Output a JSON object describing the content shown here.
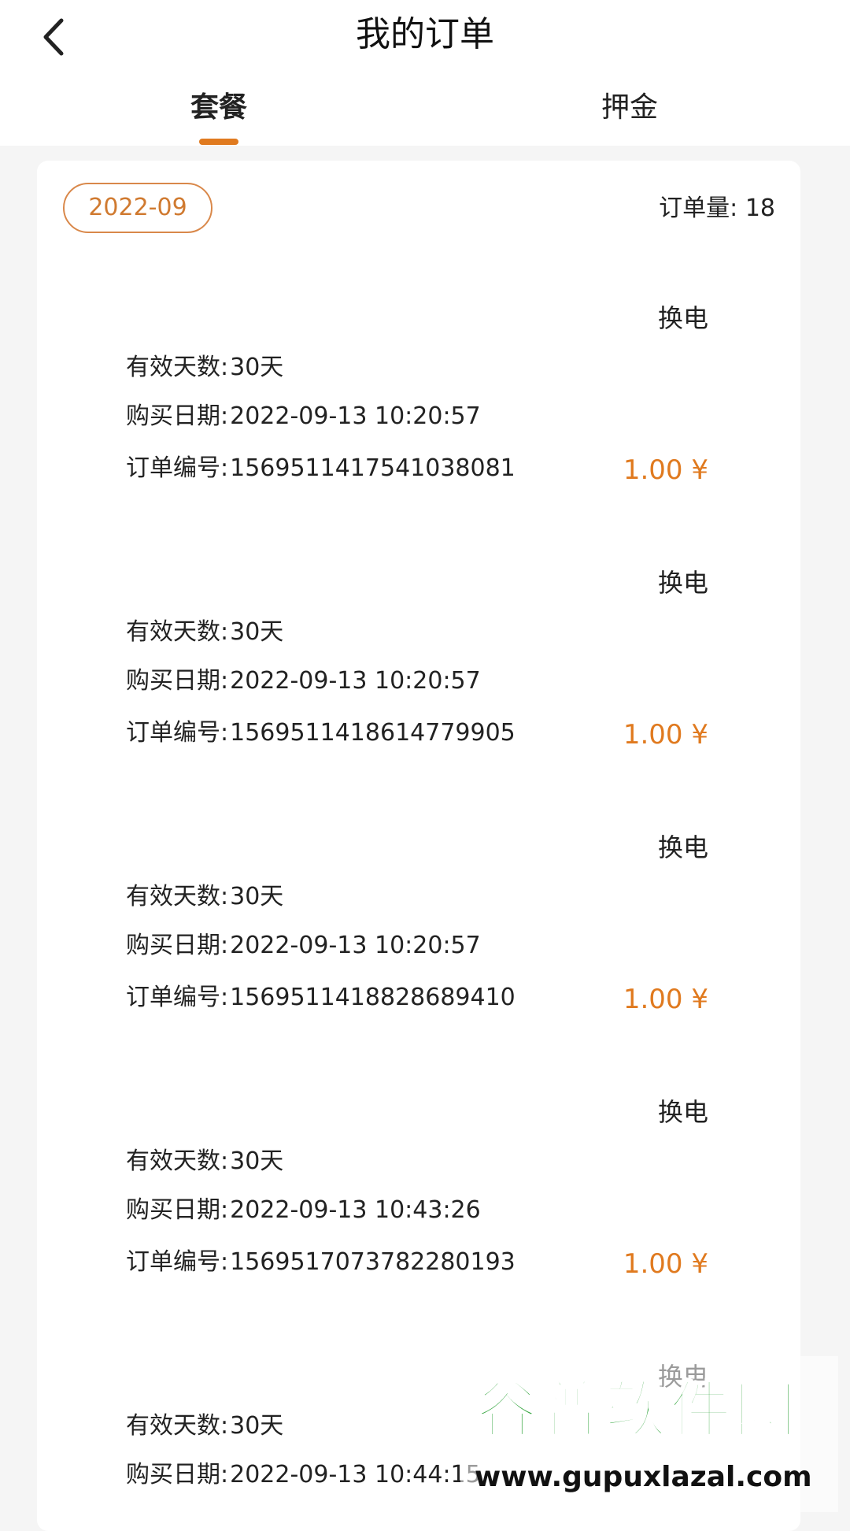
{
  "header": {
    "title": "我的订单",
    "back_icon": "chevron-left-icon"
  },
  "tabs": [
    {
      "label": "套餐",
      "active": true
    },
    {
      "label": "押金",
      "active": false
    }
  ],
  "accent_color": "#e07a1f",
  "filter": {
    "month": "2022-09",
    "count_label": "订单量:",
    "count_value": "18"
  },
  "labels": {
    "days": "有效天数:",
    "date": "购买日期:",
    "id": "订单编号:"
  },
  "orders": [
    {
      "type": "换电",
      "days": "30天",
      "date": "2022-09-13 10:20:57",
      "id": "1569511417541038081",
      "price": "1.00 ¥"
    },
    {
      "type": "换电",
      "days": "30天",
      "date": "2022-09-13 10:20:57",
      "id": "1569511418614779905",
      "price": "1.00 ¥"
    },
    {
      "type": "换电",
      "days": "30天",
      "date": "2022-09-13 10:20:57",
      "id": "1569511418828689410",
      "price": "1.00 ¥"
    },
    {
      "type": "换电",
      "days": "30天",
      "date": "2022-09-13 10:43:26",
      "id": "1569517073782280193",
      "price": "1.00 ¥"
    },
    {
      "type": "换电",
      "days": "30天",
      "date": "2022-09-13 10:44:15"
    }
  ],
  "watermark": {
    "name": "谷普软件园",
    "url": "www.gupuxlazal.com"
  }
}
